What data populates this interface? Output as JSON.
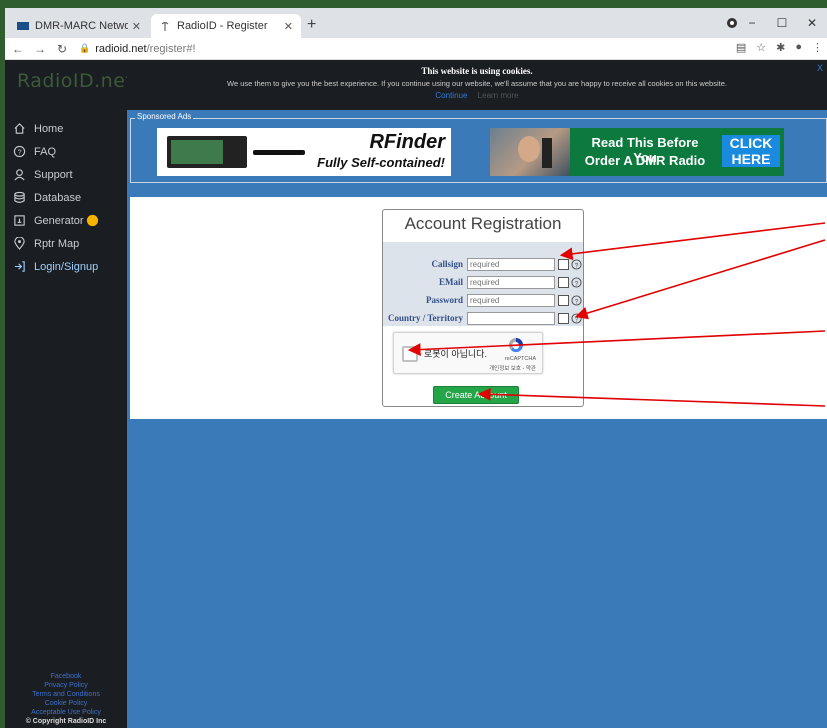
{
  "browser": {
    "tabs": [
      {
        "title": "DMR-MARC Network",
        "active": false
      },
      {
        "title": "RadioID - Register",
        "active": true
      }
    ],
    "url_host": "radioid.net",
    "url_path": "/register#!"
  },
  "site": {
    "logo": "RadioID.net"
  },
  "cookie_banner": {
    "title": "This website is using cookies.",
    "text": "We use them to give you the best experience. If you continue using our website, we'll assume that you are happy to receive all cookies on this website.",
    "continue": "Continue",
    "learn_more": "Learn more",
    "close": "X"
  },
  "sidebar": {
    "items": [
      {
        "label": "Home",
        "icon": "home-icon"
      },
      {
        "label": "FAQ",
        "icon": "question-icon"
      },
      {
        "label": "Support",
        "icon": "support-icon"
      },
      {
        "label": "Database",
        "icon": "database-icon"
      },
      {
        "label": "Generator",
        "icon": "generator-icon"
      },
      {
        "label": "Rptr Map",
        "icon": "map-pin-icon"
      },
      {
        "label": "Login/Signup",
        "icon": "login-icon"
      }
    ],
    "footer": {
      "facebook": "Facebook",
      "privacy": "Privacy Policy",
      "terms": "Terms and Conditions",
      "cookie": "Cookie Policy",
      "acceptable": "Acceptable Use Policy",
      "copyright": "© Copyright RadioID Inc"
    }
  },
  "ads": {
    "label": "Sponsored Ads",
    "ad1_title": "RFinder",
    "ad1_sub": "Fully Self-contained!",
    "ad2_line1": "Read This Before You",
    "ad2_line2": "Order A DMR Radio",
    "ad2_cta1": "CLICK",
    "ad2_cta2": "HERE"
  },
  "form": {
    "title": "Account Registration",
    "fields": [
      {
        "label": "Callsign",
        "placeholder": "required"
      },
      {
        "label": "EMail",
        "placeholder": "required"
      },
      {
        "label": "Password",
        "placeholder": "required"
      },
      {
        "label": "Country / Territory",
        "placeholder": ""
      }
    ],
    "captcha_text": "로봇이 아닙니다.",
    "captcha_brand": "reCAPTCHA",
    "captcha_links": "개인정보 보호 - 약관",
    "submit": "Create Account"
  },
  "colors": {
    "accent_green": "#23a548",
    "page_blue": "#3b7ab8",
    "arrow_red": "#e00000"
  }
}
